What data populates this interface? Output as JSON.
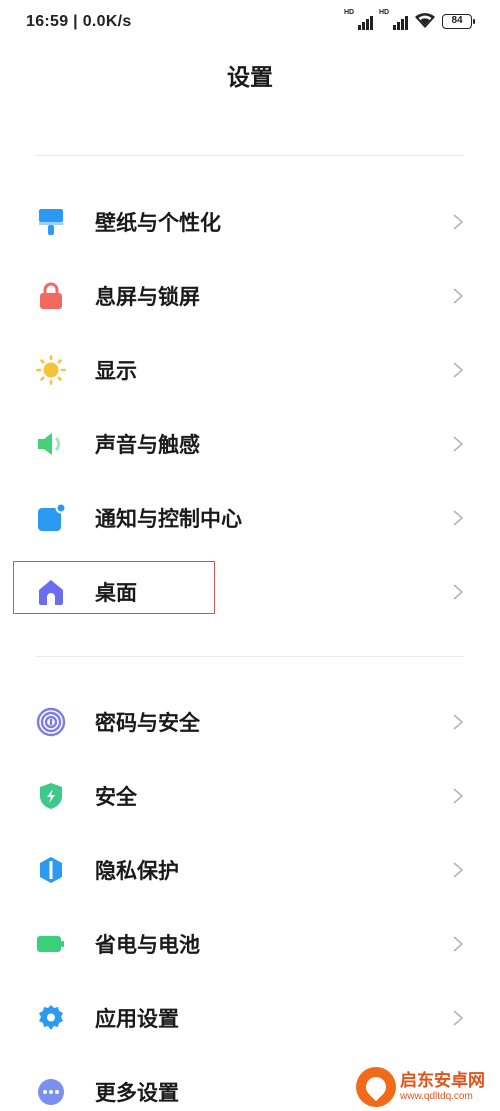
{
  "status": {
    "time_speed": "16:59 | 0.0K/s",
    "sim1": "HD",
    "sim2": "HD",
    "battery": "84"
  },
  "title": "设置",
  "groups": [
    {
      "items": [
        {
          "label": "壁纸与个性化",
          "icon": "wallpaper-brush-icon",
          "color": "#2b9af3"
        },
        {
          "label": "息屏与锁屏",
          "icon": "lock-icon",
          "color": "#f1695f"
        },
        {
          "label": "显示",
          "icon": "sun-icon",
          "color": "#f6c33b"
        },
        {
          "label": "声音与触感",
          "icon": "speaker-icon",
          "color": "#45d07a"
        },
        {
          "label": "通知与控制中心",
          "icon": "notification-icon",
          "color": "#2b9af3"
        },
        {
          "label": "桌面",
          "icon": "home-icon",
          "color": "#6c6cf0",
          "highlighted": true
        }
      ]
    },
    {
      "items": [
        {
          "label": "密码与安全",
          "icon": "fingerprint-icon",
          "color": "#7b7bea"
        },
        {
          "label": "安全",
          "icon": "shield-icon",
          "color": "#3fc88c"
        },
        {
          "label": "隐私保护",
          "icon": "privacy-icon",
          "color": "#2b9af3"
        },
        {
          "label": "省电与电池",
          "icon": "battery-icon",
          "color": "#3ccf7a"
        },
        {
          "label": "应用设置",
          "icon": "gear-icon",
          "color": "#2b9af3"
        },
        {
          "label": "更多设置",
          "icon": "more-icon",
          "color": "#7b8ff0"
        }
      ]
    }
  ],
  "watermark": {
    "name": "启东安卓网",
    "url": "www.qdltdq.com"
  }
}
